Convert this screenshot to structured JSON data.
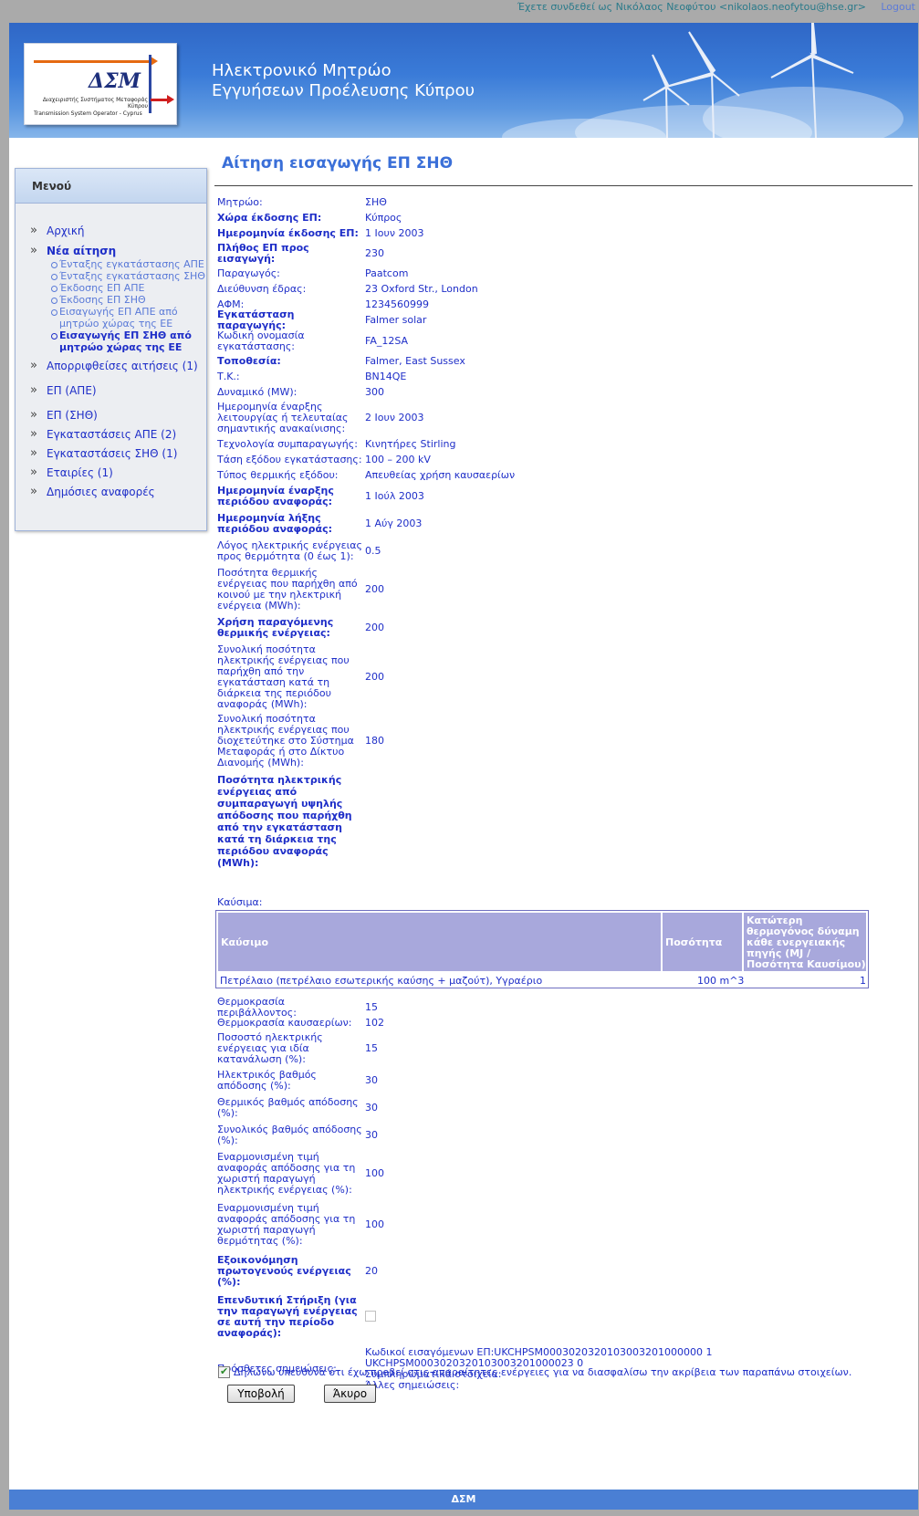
{
  "topbar": {
    "user_text": "Έχετε συνδεθεί ως Νικόλαος Νεοφύτου <nikolaos.neofytou@hse.gr>",
    "logout": "Logout"
  },
  "header": {
    "logo_text": "ΔΣΜ",
    "logo_sub1": "Διαχειριστής Συστήματος Μεταφοράς Κύπρου",
    "logo_sub2": "Transmission System Operator - Cyprus",
    "title_line1": "Ηλεκτρονικό Μητρώο",
    "title_line2": "Εγγυήσεων Προέλευσης Κύπρου"
  },
  "menu": {
    "title": "Μενού",
    "home": "Αρχική",
    "new_request": "Νέα αίτηση",
    "sub": [
      "Ένταξης εγκατάστασης ΑΠΕ",
      "Ένταξης εγκατάστασης ΣΗΘ",
      "Έκδοσης ΕΠ ΑΠΕ",
      "Έκδοσης ΕΠ ΣΗΘ",
      "Εισαγωγής ΕΠ ΑΠΕ από μητρώο χώρας της ΕΕ",
      "Εισαγωγής ΕΠ ΣΗΘ από μητρώο χώρας της ΕΕ"
    ],
    "rejected": "Απορριφθείσες αιτήσεις (1)",
    "gp_res": "ΕΠ (ΑΠΕ)",
    "gp_chp": "ΕΠ (ΣΗΘ)",
    "inst_res": "Εγκαταστάσεις ΑΠΕ (2)",
    "inst_chp": "Εγκαταστάσεις ΣΗΘ (1)",
    "companies": "Εταιρίες (1)",
    "reports": "Δημόσιες αναφορές"
  },
  "page_title": "Αίτηση εισαγωγής ΕΠ ΣΗΘ",
  "fields": [
    {
      "label": "Μητρώο:",
      "value": "ΣΗΘ"
    },
    {
      "label": "Χώρα έκδοσης ΕΠ:",
      "value": "Κύπρος"
    },
    {
      "label": "Ημερομηνία έκδοσης ΕΠ:",
      "value": "1 Ιουν 2003"
    },
    {
      "label": "Πλήθος ΕΠ προς εισαγωγή:",
      "value": "230"
    },
    {
      "label": "Παραγωγός:",
      "value": "Paatcom"
    },
    {
      "label": "Διεύθυνση έδρας:",
      "value": "23 Oxford Str., London"
    },
    {
      "label": "ΑΦΜ:",
      "value": "1234560999"
    },
    {
      "label": "Εγκατάσταση παραγωγής:",
      "value": "Falmer solar"
    },
    {
      "label": "Κωδική ονομασία εγκατάστασης:",
      "value": "FA_12SA"
    },
    {
      "label": "Τοποθεσία:",
      "value": "Falmer, East Sussex"
    },
    {
      "label": "Τ.Κ.:",
      "value": "BN14QE"
    },
    {
      "label": "Δυναμικό (MW):",
      "value": "300"
    },
    {
      "label": "Ημερομηνία έναρξης λειτουργίας ή τελευταίας σημαντικής ανακαίνισης:",
      "value": "2 Ιουν 2003"
    },
    {
      "label": "Τεχνολογία συμπαραγωγής:",
      "value": "Κινητήρες Stirling"
    },
    {
      "label": "Τάση εξόδου εγκατάστασης:",
      "value": "100 – 200 kV"
    },
    {
      "label": "Τύπος θερμικής εξόδου:",
      "value": "Απευθείας χρήση καυσαερίων"
    },
    {
      "label": "Ημερομηνία έναρξης περιόδου αναφοράς:",
      "value": "1 Ιούλ 2003"
    },
    {
      "label": "Ημερομηνία λήξης περιόδου αναφοράς:",
      "value": "1 Αύγ 2003"
    },
    {
      "label": "Λόγος ηλεκτρικής ενέργειας προς θερμότητα (0 έως 1):",
      "value": "0.5"
    },
    {
      "label": "Ποσότητα θερμικής ενέργειας που παρήχθη από κοινού με την ηλεκτρική ενέργεια (MWh):",
      "value": "200"
    },
    {
      "label": "Χρήση παραγόμενης θερμικής ενέργειας:",
      "value": "200"
    },
    {
      "label": "Συνολική ποσότητα ηλεκτρικής ενέργειας που παρήχθη από την εγκατάσταση κατά τη διάρκεια της περιόδου αναφοράς (MWh):",
      "value": "200"
    },
    {
      "label": "Συνολική ποσότητα ηλεκτρικής ενέργειας που διοχετεύτηκε στο Σύστημα Μεταφοράς ή στο Δίκτυο Διανομής (MWh):",
      "value": "180"
    },
    {
      "label": "Ποσότητα ηλεκτρικής ενέργειας από συμπαραγωγή υψηλής απόδοσης που παρήχθη από την εγκατάσταση κατά τη διάρκεια της περιόδου αναφοράς (MWh):",
      "value": ""
    },
    {
      "label": "Καύσιμα:",
      "value": ""
    }
  ],
  "fuel_table": {
    "headers": [
      "Καύσιμο",
      "Ποσότητα",
      "Κατώτερη θερμογόνος δύναμη κάθε ενεργειακής πηγής (MJ / Ποσότητα Καυσίμου)"
    ],
    "rows": [
      [
        "Πετρέλαιο (πετρέλαιο εσωτερικής καύσης + μαζούτ), Υγραέριο",
        "100 m^3",
        "1"
      ]
    ]
  },
  "fields2": [
    {
      "label": "Θερμοκρασία περιβάλλοντος:",
      "value": "15"
    },
    {
      "label": "Θερμοκρασία καυσαερίων:",
      "value": "102"
    },
    {
      "label": "Ποσοστό ηλεκτρικής ενέργειας για ιδία κατανάλωση (%):",
      "value": "15"
    },
    {
      "label": "Ηλεκτρικός βαθμός απόδοσης (%):",
      "value": "30"
    },
    {
      "label": "Θερμικός βαθμός απόδοσης (%):",
      "value": "30"
    },
    {
      "label": "Συνολικός βαθμός απόδοσης (%):",
      "value": "30"
    },
    {
      "label": "Εναρμονισμένη τιμή αναφοράς απόδοσης για τη χωριστή παραγωγή ηλεκτρικής ενέργειας (%):",
      "value": "100"
    },
    {
      "label": "Εναρμονισμένη τιμή αναφοράς απόδοσης για τη χωριστή παραγωγή θερμότητας (%):",
      "value": "100"
    },
    {
      "label": "Εξοικονόμηση πρωτογενούς ενέργειας (%):",
      "value": "20"
    },
    {
      "label": "Επενδυτική Στήριξη (για την παραγωγή ενέργειας σε αυτή την περίοδο αναφοράς):",
      "value": ""
    },
    {
      "label": "Πρόσθετες σημειώσεις:",
      "value": ""
    }
  ],
  "notes": {
    "line1": "Κωδικοί εισαγόμενων ΕΠ:UKCHPSM0003020320103003201000000 1",
    "line2": "UKCHPSM0003020320103003201000023 0",
    "line3": "Συμπληρωματικά στοιχεία:",
    "line4": "Άλλες σημειώσεις:"
  },
  "declaration": "Δηλώνω υπεύθυνα ότι έχω προβεί στις απαραίτητες ενέργειες για να διασφαλίσω την ακρίβεια των παραπάνω στοιχείων.",
  "buttons": {
    "submit": "Υποβολή",
    "cancel": "Άκυρο"
  },
  "footer": "ΔΣΜ",
  "colors": {
    "accent": "#4a7fd4",
    "text": "#1e2ec8",
    "table_head": "#a8a8dc"
  }
}
